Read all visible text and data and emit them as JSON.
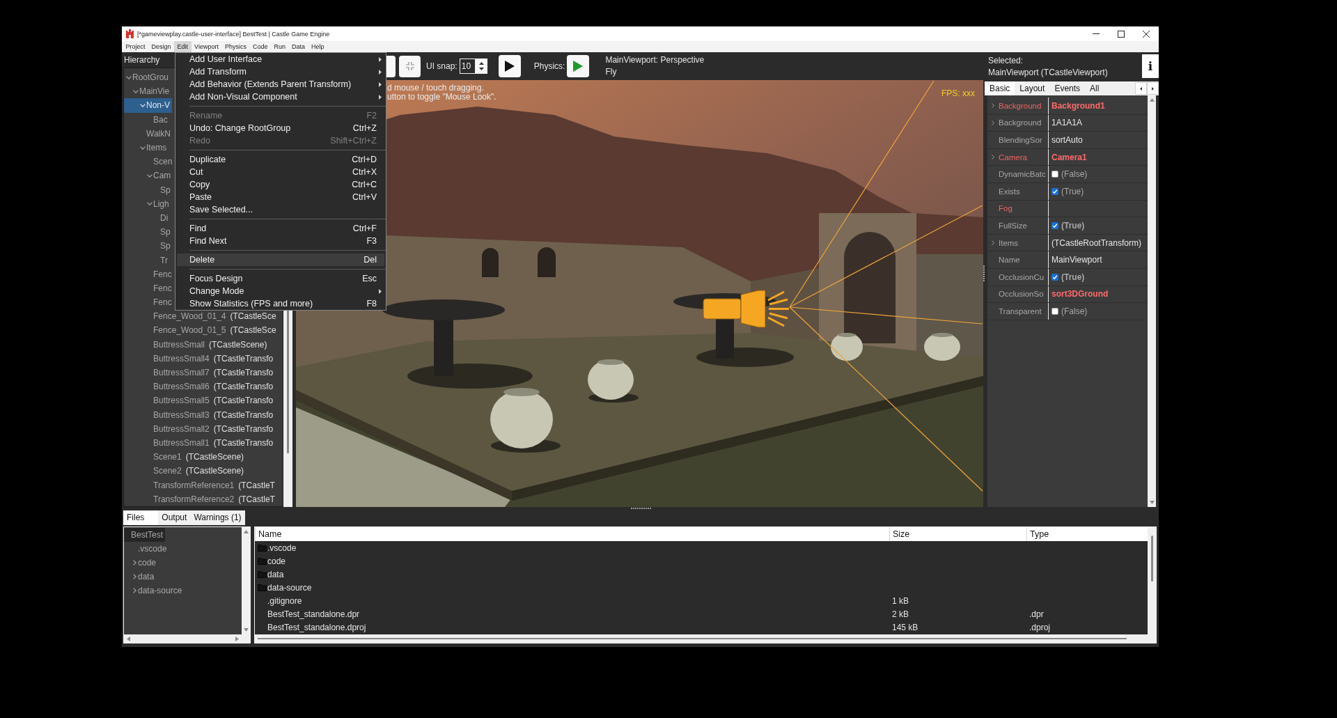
{
  "window": {
    "title": "[*gameviewplay.castle-user-interface] BestTest | Castle Game Engine"
  },
  "menu_bar": [
    {
      "label": "Project",
      "selected": false
    },
    {
      "label": "Design",
      "selected": false
    },
    {
      "label": "Edit",
      "selected": true
    },
    {
      "label": "Viewport",
      "selected": false
    },
    {
      "label": "Physics",
      "selected": false
    },
    {
      "label": "Code",
      "selected": false
    },
    {
      "label": "Run",
      "selected": false
    },
    {
      "label": "Data",
      "selected": false
    },
    {
      "label": "Help",
      "selected": false
    }
  ],
  "edit_menu": {
    "sections": [
      {
        "items": [
          {
            "label": "Add User Interface",
            "submenu": true,
            "disabled": false,
            "selected": false
          },
          {
            "label": "Add Transform",
            "submenu": true,
            "disabled": false,
            "selected": false
          },
          {
            "label": "Add Behavior (Extends Parent Transform)",
            "submenu": true,
            "disabled": false,
            "selected": false
          },
          {
            "label": "Add Non-Visual Component",
            "submenu": true,
            "disabled": false,
            "selected": false
          }
        ]
      },
      {
        "items": [
          {
            "label": "Rename",
            "shortcut": "F2",
            "submenu": false,
            "disabled": true,
            "selected": false
          },
          {
            "label": "Undo: Change RootGroup",
            "shortcut": "Ctrl+Z",
            "submenu": false,
            "disabled": false,
            "selected": false
          },
          {
            "label": "Redo",
            "shortcut": "Shift+Ctrl+Z",
            "submenu": false,
            "disabled": true,
            "selected": false
          }
        ]
      },
      {
        "items": [
          {
            "label": "Duplicate",
            "shortcut": "Ctrl+D",
            "submenu": false,
            "disabled": false,
            "selected": false
          },
          {
            "label": "Cut",
            "shortcut": "Ctrl+X",
            "submenu": false,
            "disabled": false,
            "selected": false
          },
          {
            "label": "Copy",
            "shortcut": "Ctrl+C",
            "submenu": false,
            "disabled": false,
            "selected": false
          },
          {
            "label": "Paste",
            "shortcut": "Ctrl+V",
            "submenu": false,
            "disabled": false,
            "selected": false
          },
          {
            "label": "Save Selected...",
            "submenu": false,
            "disabled": false,
            "selected": false
          }
        ]
      },
      {
        "items": [
          {
            "label": "Find",
            "shortcut": "Ctrl+F",
            "submenu": false,
            "disabled": false,
            "selected": false
          },
          {
            "label": "Find Next",
            "shortcut": "F3",
            "submenu": false,
            "disabled": false,
            "selected": false
          }
        ]
      },
      {
        "items": [
          {
            "label": "Delete",
            "shortcut": "Del",
            "submenu": false,
            "disabled": false,
            "selected": true
          }
        ]
      },
      {
        "items": [
          {
            "label": "Focus Design",
            "shortcut": "Esc",
            "submenu": false,
            "disabled": false,
            "selected": false
          },
          {
            "label": "Change Mode",
            "submenu": true,
            "disabled": false,
            "selected": false
          },
          {
            "label": "Show Statistics (FPS and more)",
            "shortcut": "F8",
            "submenu": false,
            "disabled": false,
            "selected": false
          }
        ]
      }
    ]
  },
  "hierarchy": {
    "title": "Hierarchy",
    "tree": [
      {
        "name": "RootGrou",
        "selected": false,
        "expanded": true,
        "children": [
          {
            "name": "MainVie",
            "selected": false,
            "expanded": true,
            "children": [
              {
                "name": "Non-V",
                "selected": true,
                "expanded": true,
                "children": [
                  {
                    "name": "Bac",
                    "selected": false
                  }
                ]
              },
              {
                "name": "WalkN",
                "selected": false
              },
              {
                "name": "Items",
                "selected": false,
                "expanded": true,
                "children": [
                  {
                    "name": "Scen",
                    "selected": false
                  },
                  {
                    "name": "Cam",
                    "selected": false,
                    "expanded": true,
                    "children": [
                      {
                        "name": "Sp",
                        "selected": false
                      }
                    ]
                  },
                  {
                    "name": "Ligh",
                    "selected": false,
                    "expanded": true,
                    "children": [
                      {
                        "name": "Di",
                        "selected": false
                      },
                      {
                        "name": "Sp",
                        "selected": false
                      },
                      {
                        "name": "Sp",
                        "selected": false
                      },
                      {
                        "name": "Tr",
                        "selected": false
                      }
                    ]
                  },
                  {
                    "name": "Fenc",
                    "selected": false
                  },
                  {
                    "name": "Fenc",
                    "selected": false
                  },
                  {
                    "name": "Fenc",
                    "selected": false
                  },
                  {
                    "name": "Fence_Wood_01_4",
                    "type": "(TCastleSce",
                    "selected": false
                  },
                  {
                    "name": "Fence_Wood_01_5",
                    "type": "(TCastleSce",
                    "selected": false
                  },
                  {
                    "name": "ButtressSmall",
                    "type": "(TCastleScene)",
                    "selected": false
                  },
                  {
                    "name": "ButtressSmall4",
                    "type": "(TCastleTransfo",
                    "selected": false
                  },
                  {
                    "name": "ButtressSmall7",
                    "type": "(TCastleTransfo",
                    "selected": false
                  },
                  {
                    "name": "ButtressSmall6",
                    "type": "(TCastleTransfo",
                    "selected": false
                  },
                  {
                    "name": "ButtressSmall5",
                    "type": "(TCastleTransfo",
                    "selected": false
                  },
                  {
                    "name": "ButtressSmall3",
                    "type": "(TCastleTransfo",
                    "selected": false
                  },
                  {
                    "name": "ButtressSmall2",
                    "type": "(TCastleTransfo",
                    "selected": false
                  },
                  {
                    "name": "ButtressSmall1",
                    "type": "(TCastleTransfo",
                    "selected": false
                  },
                  {
                    "name": "Scene1",
                    "type": "(TCastleScene)",
                    "selected": false
                  },
                  {
                    "name": "Scene2",
                    "type": "(TCastleScene)",
                    "selected": false
                  },
                  {
                    "name": "TransformReference1",
                    "type": "(TCastleT",
                    "selected": false
                  },
                  {
                    "name": "TransformReference2",
                    "type": "(TCastleT",
                    "selected": false
                  }
                ]
              }
            ]
          }
        ]
      }
    ]
  },
  "toolbar": {
    "snap_label": "UI snap:",
    "snap_value": "10",
    "physics_label": "Physics:",
    "view_info": [
      "MainViewport: Perspective",
      "Fly"
    ]
  },
  "viewport": {
    "hints": [
      "d mouse / touch dragging.",
      "utton to toggle \"Mouse Look\"."
    ],
    "fps": "FPS: xxx"
  },
  "inspector": {
    "selected_label": "Selected:",
    "selected_name": "MainViewport (TCastleViewport)",
    "info_label": "i",
    "tabs": [
      {
        "label": "Basic",
        "selected": true
      },
      {
        "label": "Layout",
        "selected": false
      },
      {
        "label": "Events",
        "selected": false
      },
      {
        "label": "All",
        "selected": false
      }
    ],
    "properties": [
      {
        "name": "Background",
        "name_highlighted": true,
        "kind": "text",
        "value": "Background1",
        "value_highlighted": true,
        "modified": true,
        "expandable": true
      },
      {
        "name": "Background",
        "name_highlighted": false,
        "kind": "text",
        "value": "1A1A1A",
        "value_highlighted": false,
        "modified": false,
        "expandable": true
      },
      {
        "name": "BlendingSor",
        "name_highlighted": false,
        "kind": "text",
        "value": "sortAuto",
        "value_highlighted": false,
        "modified": false,
        "expandable": false
      },
      {
        "name": "Camera",
        "name_highlighted": true,
        "kind": "text",
        "value": "Camera1",
        "value_highlighted": true,
        "modified": true,
        "expandable": true
      },
      {
        "name": "DynamicBatc",
        "name_highlighted": false,
        "kind": "bool",
        "checked": false,
        "value": "(False)",
        "value_highlighted": false,
        "modified": false,
        "expandable": false
      },
      {
        "name": "Exists",
        "name_highlighted": false,
        "kind": "bool",
        "checked": true,
        "value": "(True)",
        "value_highlighted": false,
        "modified": false,
        "expandable": false
      },
      {
        "name": "Fog",
        "name_highlighted": true,
        "kind": "text",
        "expandable": false
      },
      {
        "name": "FullSize",
        "name_highlighted": false,
        "kind": "bool",
        "checked": true,
        "value": "(True)",
        "value_highlighted": false,
        "modified": true,
        "expandable": false
      },
      {
        "name": "Items",
        "name_highlighted": false,
        "kind": "text",
        "value": "(TCastleRootTransform)",
        "value_highlighted": false,
        "modified": false,
        "expandable": true
      },
      {
        "name": "Name",
        "name_highlighted": false,
        "kind": "text",
        "value": "MainViewport",
        "value_highlighted": false,
        "modified": false,
        "expandable": false
      },
      {
        "name": "OcclusionCu",
        "name_highlighted": false,
        "kind": "bool",
        "checked": true,
        "value": "(True)",
        "value_highlighted": false,
        "modified": true,
        "expandable": false
      },
      {
        "name": "OcclusionSo",
        "name_highlighted": false,
        "kind": "text",
        "value": "sort3DGround",
        "value_highlighted": true,
        "modified": true,
        "expandable": false
      },
      {
        "name": "Transparent",
        "name_highlighted": false,
        "kind": "bool",
        "checked": false,
        "value": "(False)",
        "value_highlighted": false,
        "modified": false,
        "expandable": false
      }
    ]
  },
  "bottom_panel": {
    "tabs": [
      {
        "label": "Files",
        "selected": true
      },
      {
        "label": "Output",
        "selected": false
      },
      {
        "label": "Warnings (1)",
        "selected": false
      }
    ],
    "file_tree": [
      {
        "name": "BestTest",
        "selected": true,
        "children": [
          {
            "name": ".vscode",
            "selected": false
          },
          {
            "name": "code",
            "selected": false,
            "expanded": false
          },
          {
            "name": "data",
            "selected": false,
            "expanded": false
          },
          {
            "name": "data-source",
            "selected": false,
            "expanded": false
          }
        ]
      }
    ],
    "file_list": {
      "columns": [
        "Name",
        "Size",
        "Type"
      ],
      "rows": [
        {
          "kind": "folder",
          "name": ".vscode"
        },
        {
          "kind": "folder",
          "name": "code"
        },
        {
          "kind": "folder",
          "name": "data"
        },
        {
          "kind": "folder",
          "name": "data-source"
        },
        {
          "kind": "file",
          "name": ".gitignore",
          "size": "1 kB"
        },
        {
          "kind": "file",
          "name": "BestTest_standalone.dpr",
          "size": "2 kB",
          "type": ".dpr"
        },
        {
          "kind": "file",
          "name": "BestTest_standalone.dproj",
          "size": "145 kB",
          "type": ".dproj"
        }
      ]
    }
  }
}
